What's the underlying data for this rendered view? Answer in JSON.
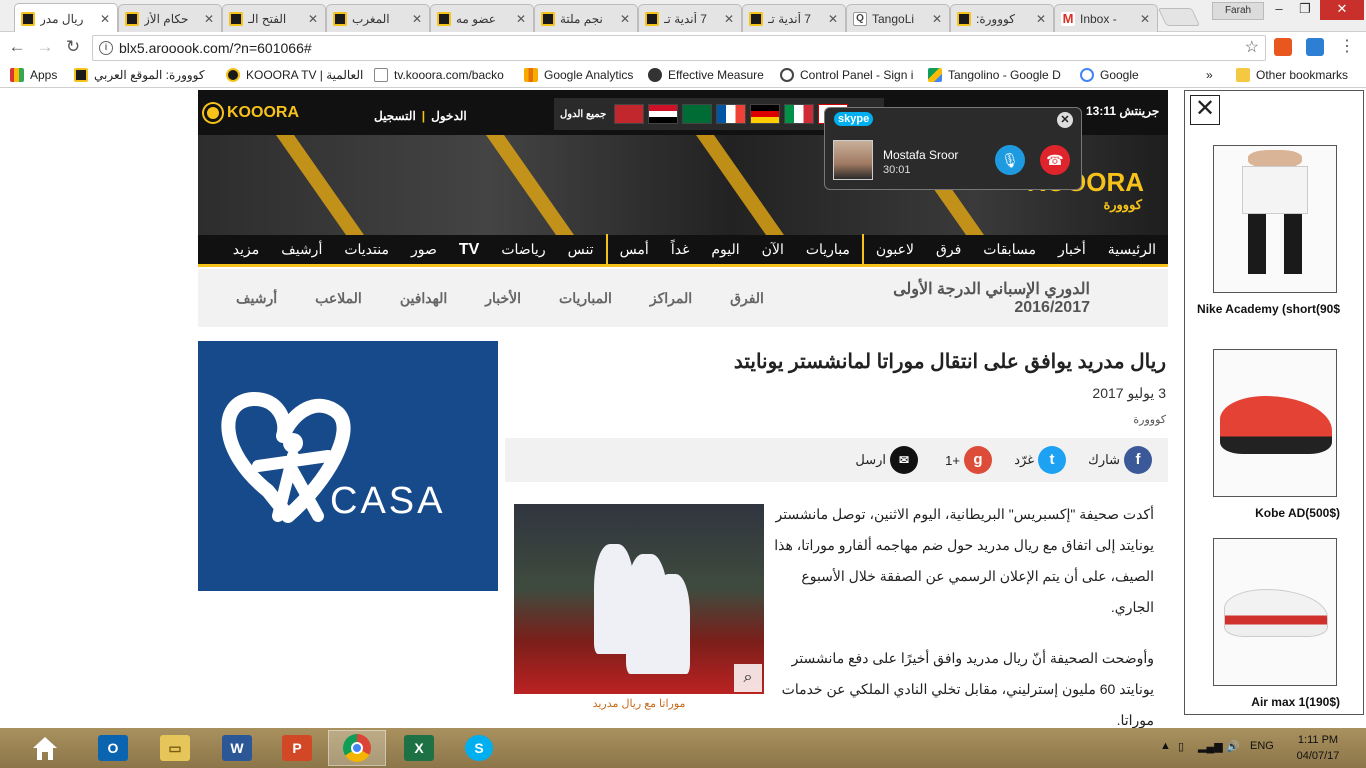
{
  "browser": {
    "tabs": [
      {
        "title": "ريال مدر",
        "icon": "kooora-icon",
        "active": true
      },
      {
        "title": "حكام الأز",
        "icon": "kooora-icon"
      },
      {
        "title": "الفتح الـ",
        "icon": "kooora-icon"
      },
      {
        "title": "المغرب",
        "icon": "kooora-icon"
      },
      {
        "title": "عضو مه",
        "icon": "kooora-icon"
      },
      {
        "title": "نجم ملتة",
        "icon": "kooora-icon"
      },
      {
        "title": "7 أندية تـ",
        "icon": "kooora-icon"
      },
      {
        "title": "7 أندية تـ",
        "icon": "kooora-icon"
      },
      {
        "title": "TangoLi",
        "icon": "tangolino-icon"
      },
      {
        "title": "كووورة:",
        "icon": "kooora-icon"
      },
      {
        "title": "Inbox -",
        "icon": "gmail-icon"
      }
    ],
    "profile_name": "Farah",
    "url": "blx5.arooook.com/?n=601066#",
    "bookmarks": [
      {
        "label": "Apps"
      },
      {
        "label": "كووورة: الموقع العربي"
      },
      {
        "label": "KOOORA TV | العالمية"
      },
      {
        "label": "tv.kooora.com/backo"
      },
      {
        "label": "Google Analytics"
      },
      {
        "label": "Effective Measure"
      },
      {
        "label": "Control Panel - Sign i"
      },
      {
        "label": "Tangolino - Google D"
      },
      {
        "label": "Google"
      }
    ],
    "bookmarks_more": "»",
    "other_bookmarks": "Other bookmarks"
  },
  "site": {
    "logo_text": "KOOORA",
    "login": "الدخول",
    "register": "التسجيل",
    "all_countries": "جميع الدول",
    "time": "13:11",
    "timezone": "جرينتش",
    "banner_brand": "KOOORA",
    "banner_brand_ar": "كووورة",
    "main_nav": [
      "الرئيسية",
      "أخبار",
      "مسابقات",
      "فرق",
      "لاعبون",
      "مباريات",
      "الآن",
      "اليوم",
      "غداً",
      "أمس",
      "تنس",
      "رياضات",
      "TV",
      "صور",
      "منتديات",
      "أرشيف",
      "مزيد"
    ],
    "league_title": "الدوري الإسباني الدرجة الأولى 2016/2017",
    "sub_nav": [
      "الفرق",
      "المراكز",
      "المباريات",
      "الأخبار",
      "الهدافين",
      "الملاعب",
      "أرشيف"
    ]
  },
  "ad": {
    "brand": "CASA",
    "color": "#174a8a"
  },
  "article": {
    "title": "ريال مدريد يوافق على انتقال موراتا لمانشستر يونايتد",
    "date": "3 يوليو 2017",
    "source": "كووورة",
    "share": {
      "share": "شارك",
      "tweet": "غرّد",
      "gplus": "+1",
      "send": "ارسل"
    },
    "paragraphs": [
      "أكدت صحيفة \"إكسبريس\" البريطانية، اليوم الاثنين، توصل مانشستر يونايتد إلى اتفاق مع ريال مدريد حول ضم مهاجمه ألفارو موراتا، هذا الصيف، على أن يتم الإعلان الرسمي عن الصفقة خلال الأسبوع الجاري.",
      "وأوضحت الصحيفة أنّ ريال مدريد وافق أخيرًا على دفع مانشستر يونايتد 60 مليون إسترليني، مقابل تخلي النادي الملكي عن خدمات موراتا."
    ],
    "photo_caption": "موراتا مع ريال مدريد"
  },
  "skype": {
    "brand": "skype",
    "caller": "Mostafa Sroor",
    "duration": "30:01"
  },
  "sidepanel": {
    "products": [
      {
        "label": "Nike Academy (short(90$"
      },
      {
        "label": "Kobe AD(500$)"
      },
      {
        "label": "Air max 1(190$)"
      }
    ]
  },
  "taskbar": {
    "language": "ENG",
    "time": "1:11 PM",
    "date": "04/07/17",
    "apps": [
      "home-icon",
      "outlook-icon",
      "explorer-icon",
      "word-icon",
      "powerpoint-icon",
      "chrome-icon",
      "excel-icon",
      "skype-icon"
    ]
  }
}
